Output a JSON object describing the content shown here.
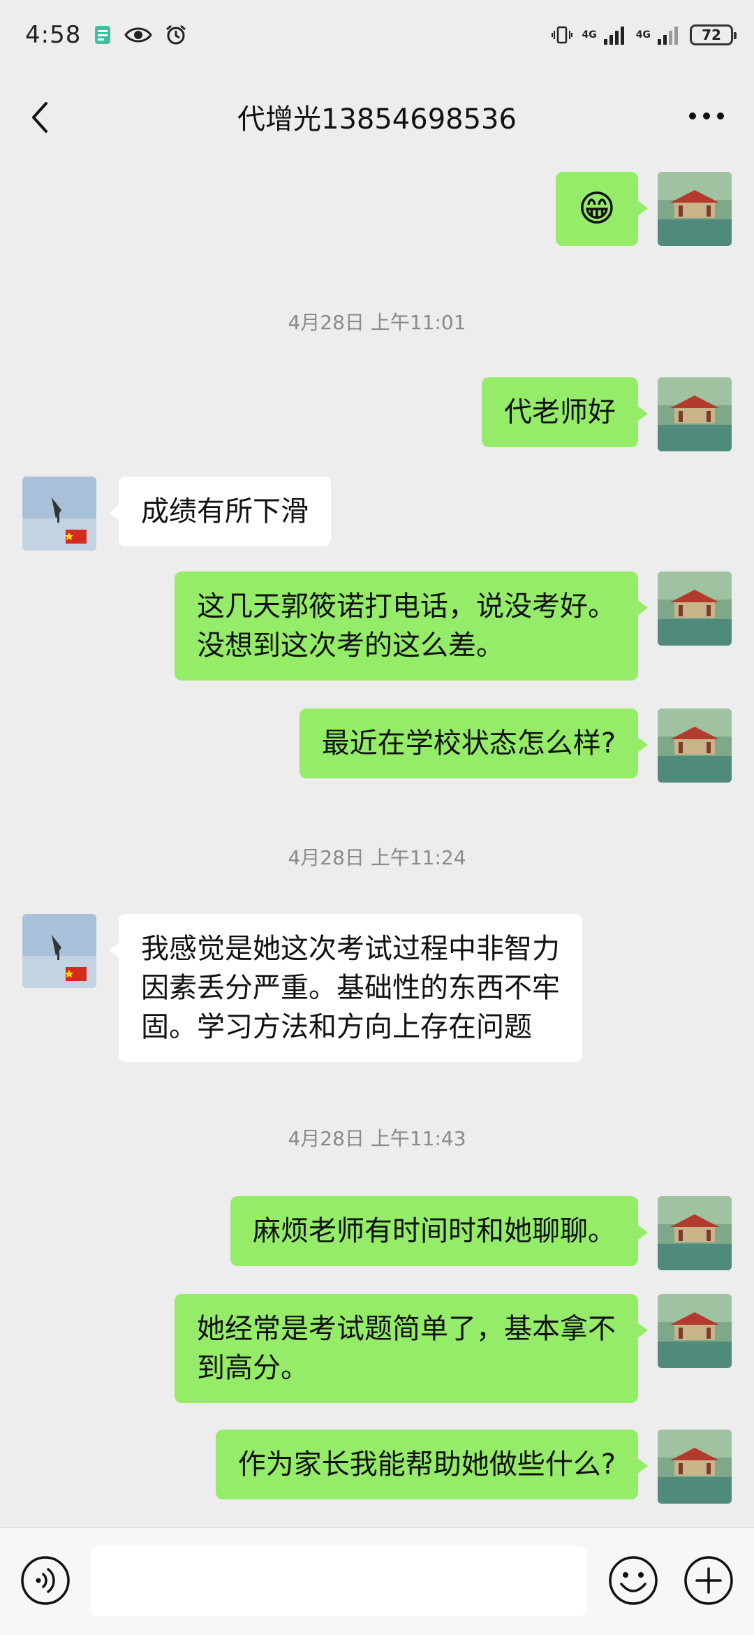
{
  "status_bar": {
    "time": "4:58",
    "network_1": "4G",
    "network_2": "4G",
    "battery": "72"
  },
  "nav": {
    "title": "代增光13854698536"
  },
  "chat": {
    "messages": [
      {
        "side": "out",
        "type": "emoji",
        "emoji": "😁"
      },
      {
        "type": "timestamp",
        "text": "4月28日 上午11:01"
      },
      {
        "side": "out",
        "text": "代老师好"
      },
      {
        "side": "in",
        "text": "成绩有所下滑"
      },
      {
        "side": "out",
        "line1": "这几天郭筱诺打电话，说没考好。",
        "line2": "没想到这次考的这么差。"
      },
      {
        "side": "out",
        "text": "最近在学校状态怎么样?"
      },
      {
        "type": "timestamp",
        "text": "4月28日 上午11:24"
      },
      {
        "side": "in",
        "line1": "我感觉是她这次考试过程中非智力",
        "line2": "因素丢分严重。基础性的东西不牢",
        "line3": "固。学习方法和方向上存在问题"
      },
      {
        "type": "timestamp",
        "text": "4月28日 上午11:43"
      },
      {
        "side": "out",
        "text": "麻烦老师有时间时和她聊聊。"
      },
      {
        "side": "out",
        "line1": "她经常是考试题简单了，基本拿不",
        "line2": "到高分。"
      },
      {
        "side": "out",
        "text": "作为家长我能帮助她做些什么?"
      }
    ]
  },
  "colors": {
    "outgoing_bubble": "#95ec69",
    "incoming_bubble": "#ffffff",
    "background": "#ededed"
  }
}
